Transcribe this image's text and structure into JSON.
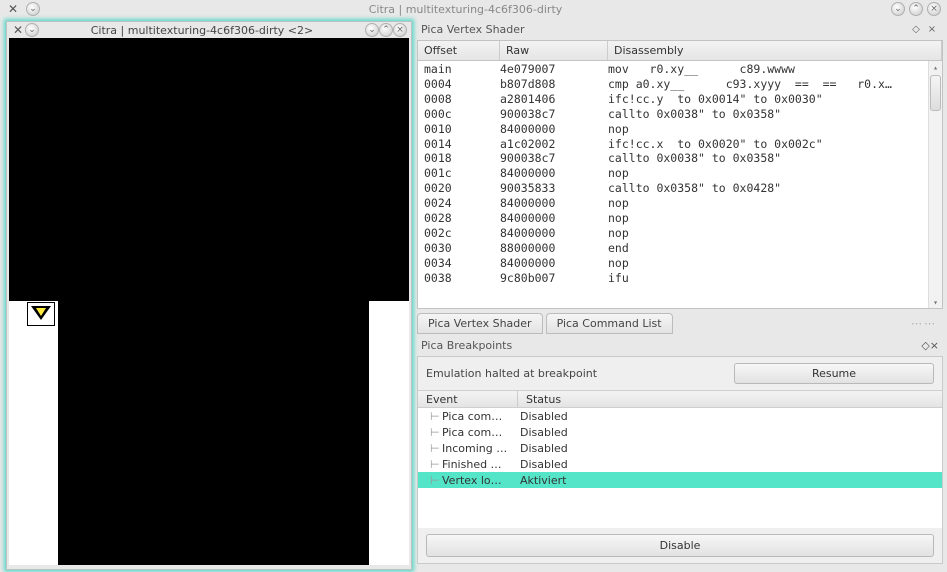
{
  "main_window": {
    "title": "Citra | multitexturing-4c6f306-dirty"
  },
  "child_window": {
    "title": "Citra | multitexturing-4c6f306-dirty <2>"
  },
  "shader_panel": {
    "title": "Pica Vertex Shader",
    "columns": {
      "offset": "Offset",
      "raw": "Raw",
      "disasm": "Disassembly"
    },
    "rows": [
      {
        "offset": "main",
        "raw": "4e079007",
        "disasm": "mov   r0.xy__      c89.wwww"
      },
      {
        "offset": "0004",
        "raw": "b807d808",
        "disasm": "cmp a0.xy__      c93.xyyy  ==  ==   r0.x…"
      },
      {
        "offset": "0008",
        "raw": "a2801406",
        "disasm": "ifc!cc.y  to 0x0014\" to 0x0030\""
      },
      {
        "offset": "000c",
        "raw": "900038c7",
        "disasm": "callto 0x0038\" to 0x0358\""
      },
      {
        "offset": "0010",
        "raw": "84000000",
        "disasm": "nop"
      },
      {
        "offset": "0014",
        "raw": "a1c02002",
        "disasm": "ifc!cc.x  to 0x0020\" to 0x002c\""
      },
      {
        "offset": "0018",
        "raw": "900038c7",
        "disasm": "callto 0x0038\" to 0x0358\""
      },
      {
        "offset": "001c",
        "raw": "84000000",
        "disasm": "nop"
      },
      {
        "offset": "0020",
        "raw": "90035833",
        "disasm": "callto 0x0358\" to 0x0428\""
      },
      {
        "offset": "0024",
        "raw": "84000000",
        "disasm": "nop"
      },
      {
        "offset": "0028",
        "raw": "84000000",
        "disasm": "nop"
      },
      {
        "offset": "002c",
        "raw": "84000000",
        "disasm": "nop"
      },
      {
        "offset": "0030",
        "raw": "88000000",
        "disasm": "end"
      },
      {
        "offset": "0034",
        "raw": "84000000",
        "disasm": "nop"
      },
      {
        "offset": "0038",
        "raw": "9c80b007",
        "disasm": "ifu"
      }
    ]
  },
  "tabs": {
    "vertex_shader": "Pica Vertex Shader",
    "command_list": "Pica Command List"
  },
  "breakpoints_panel": {
    "title": "Pica Breakpoints",
    "halt_message": "Emulation halted at breakpoint",
    "resume_button": "Resume",
    "columns": {
      "event": "Event",
      "status": "Status"
    },
    "rows": [
      {
        "event": "Pica com…",
        "status": "Disabled",
        "active": false
      },
      {
        "event": "Pica com…",
        "status": "Disabled",
        "active": false
      },
      {
        "event": "Incoming …",
        "status": "Disabled",
        "active": false
      },
      {
        "event": "Finished …",
        "status": "Disabled",
        "active": false
      },
      {
        "event": "Vertex lo…",
        "status": "Aktiviert",
        "active": true
      }
    ],
    "disable_button": "Disable"
  }
}
